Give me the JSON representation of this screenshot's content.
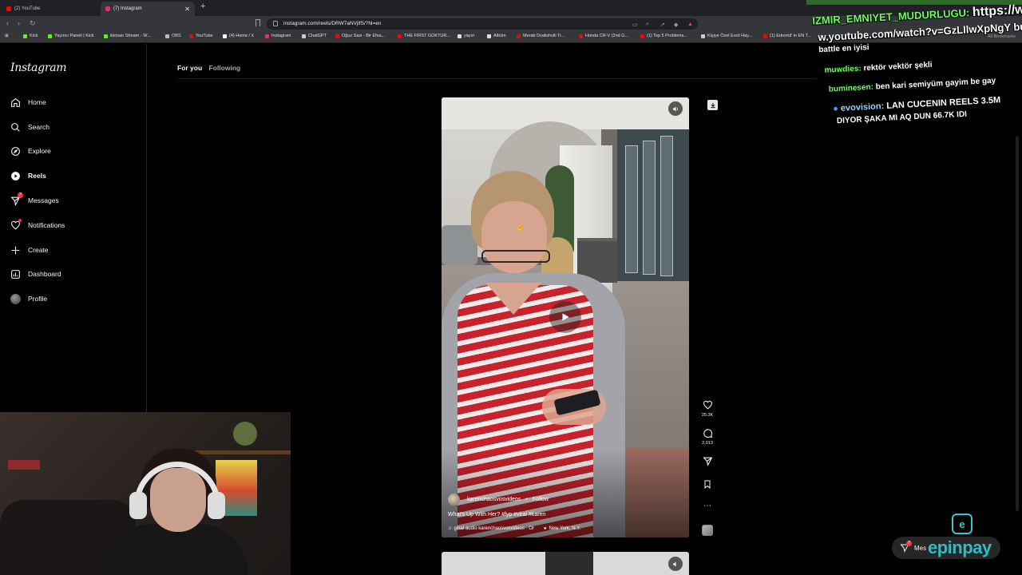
{
  "browser": {
    "tabs": [
      {
        "label": "(2) YouTube",
        "color": "#ff0000"
      },
      {
        "label": "(7) Instagram",
        "color": "#e1306c"
      }
    ],
    "url": "instagram.com/reels/DRW7aNVjifS/?hl=en",
    "bookmarks": [
      {
        "label": "Kick",
        "color": "#53fc18"
      },
      {
        "label": "Yayıncı Paneli | Kick",
        "color": "#53fc18"
      },
      {
        "label": "ikinsan Stream - W...",
        "color": "#53fc18"
      },
      {
        "label": "OBS",
        "color": "#bbbbbb"
      },
      {
        "label": "YouTube",
        "color": "#ff0000"
      },
      {
        "label": "(4) Home / X",
        "color": "#ffffff"
      },
      {
        "label": "Instagram",
        "color": "#e1306c"
      },
      {
        "label": "ChatGPT",
        "color": "#cccccc"
      },
      {
        "label": "Oğuz Sasi - Bir Efsa...",
        "color": "#ff0000"
      },
      {
        "label": "THE FIRST GOKTUR...",
        "color": "#ff0000"
      },
      {
        "label": "yayın",
        "color": "#dddddd"
      },
      {
        "label": "Albüm",
        "color": "#dddddd"
      },
      {
        "label": "Merab Dvalishvili Tr...",
        "color": "#ff0000"
      },
      {
        "label": "Honda CR-V (2nd G...",
        "color": "#ff0000"
      },
      {
        "label": "(1) Top 5 Problems...",
        "color": "#ff0000"
      },
      {
        "label": "Kişiye Özel Evcil Hay...",
        "color": "#cccccc"
      },
      {
        "label": "(1) Edremit' in EN T...",
        "color": "#ff0000"
      }
    ],
    "all_bookmarks": "All Bookmarks"
  },
  "sidebar": {
    "logo": "Instagram",
    "items": [
      {
        "label": "Home",
        "icon": "home-icon"
      },
      {
        "label": "Search",
        "icon": "search-icon"
      },
      {
        "label": "Explore",
        "icon": "compass-icon"
      },
      {
        "label": "Reels",
        "icon": "reels-icon"
      },
      {
        "label": "Messages",
        "icon": "paper-plane-icon",
        "badge": "7"
      },
      {
        "label": "Notifications",
        "icon": "heart-icon"
      },
      {
        "label": "Create",
        "icon": "plus-icon"
      },
      {
        "label": "Dashboard",
        "icon": "dashboard-icon"
      },
      {
        "label": "Profile",
        "icon": "avatar"
      }
    ]
  },
  "feed_tabs": {
    "for_you": "For you",
    "following": "Following"
  },
  "reel": {
    "username": "karenchaosvosvideos",
    "separator": "•",
    "follow": "Follow",
    "caption": "What's Up With Her? #fyp #viral #karen",
    "audio": "ginal audio  karenchaosvosvideos · Or",
    "location": "New York, N.Y."
  },
  "actions": {
    "likes": "25.3K",
    "comments": "2,013"
  },
  "chat": {
    "messages": [
      {
        "user": "IZMIR_EMNIYET_MUDURLUGU:",
        "text": "https://ww"
      },
      {
        "user": "",
        "text": "w.youtube.com/watch?v=GzLIlwXpNgY bu"
      },
      {
        "user": "",
        "text": "battle en iyisi"
      },
      {
        "user": "muwdies:",
        "text": "rektör vektör şekli"
      },
      {
        "user": "buminesen:",
        "text": "ben kari semiyüm gayim be gay"
      },
      {
        "user": "evovision:",
        "text": "LAN CUCENIN REELS 3.5M"
      },
      {
        "user": "",
        "text": "DIYOR ŞAKA MI AQ DUN 66.7K IDI"
      }
    ]
  },
  "messages_pill": {
    "label": "Mes",
    "badge": "7"
  },
  "sponsor": {
    "name": "epinpay",
    "mark": "e"
  }
}
